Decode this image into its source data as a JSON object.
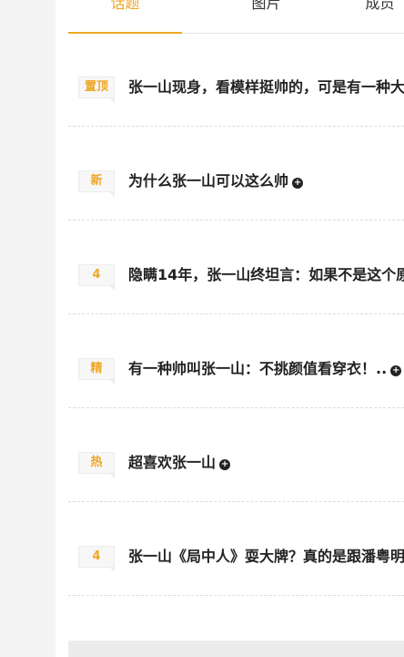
{
  "tabs": [
    {
      "label": "话题",
      "active": true
    },
    {
      "label": "图片",
      "active": false
    },
    {
      "label": "成员",
      "active": false
    }
  ],
  "topics": [
    {
      "badge": "置顶",
      "title": "张一山现身，看模样挺帅的，可是有一种大",
      "has_icon": false
    },
    {
      "badge": "新",
      "title": "为什么张一山可以这么帅",
      "has_icon": true
    },
    {
      "badge": "4",
      "title": "隐瞒14年，张一山终坦言：如果不是这个原",
      "has_icon": false
    },
    {
      "badge": "精",
      "title": "有一种帅叫张一山：不挑颜值看穿衣！..",
      "has_icon": true
    },
    {
      "badge": "热",
      "title": "超喜欢张一山",
      "has_icon": true
    },
    {
      "badge": "4",
      "title": "张一山《局中人》耍大牌？真的是跟潘粤明",
      "has_icon": false
    }
  ],
  "icons": {
    "title_suffix": "plus-circle-icon"
  },
  "colors": {
    "accent": "#f0a623",
    "background": "#f4f4f4",
    "panel": "#ffffff"
  }
}
